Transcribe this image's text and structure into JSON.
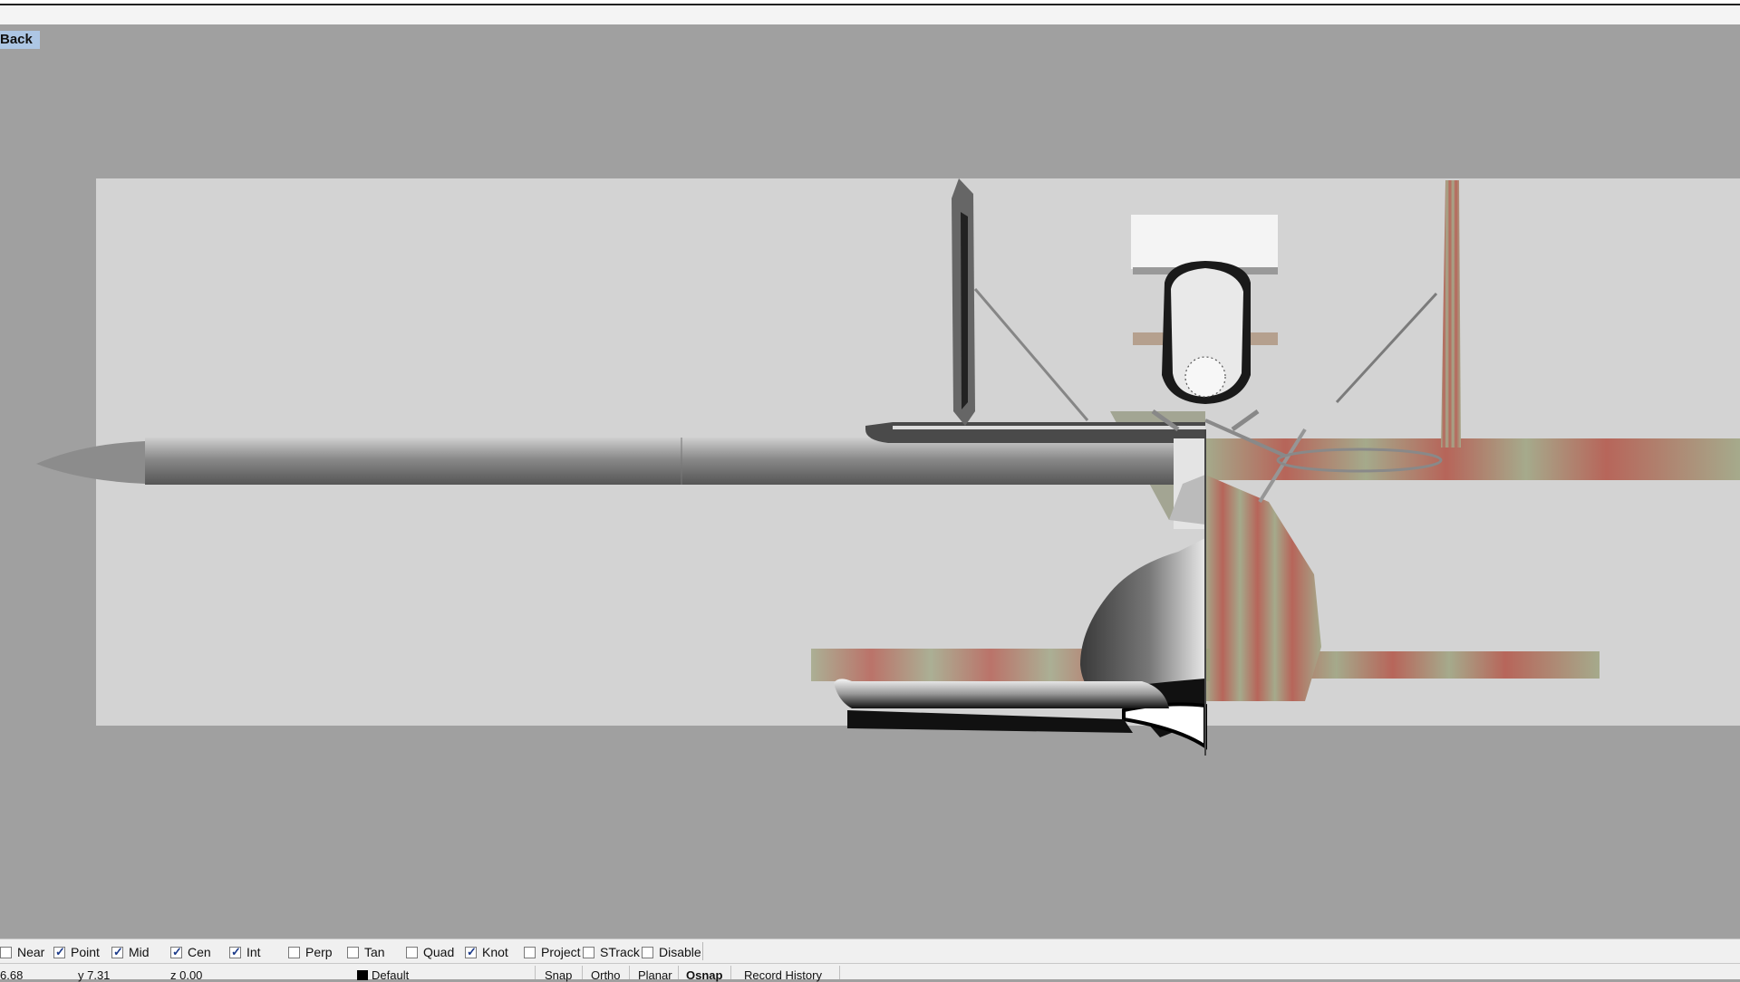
{
  "viewport": {
    "label": "Back"
  },
  "osnap": [
    {
      "label": "Near",
      "checked": false
    },
    {
      "label": "Point",
      "checked": true
    },
    {
      "label": "Mid",
      "checked": true
    },
    {
      "label": "Cen",
      "checked": true
    },
    {
      "label": "Int",
      "checked": true
    },
    {
      "label": "Perp",
      "checked": false
    },
    {
      "label": "Tan",
      "checked": false
    },
    {
      "label": "Quad",
      "checked": false
    },
    {
      "label": "Knot",
      "checked": true
    },
    {
      "label": "Project",
      "checked": false
    },
    {
      "label": "STrack",
      "checked": false
    },
    {
      "label": "Disable",
      "checked": false
    }
  ],
  "status": {
    "x": "6.68",
    "y": "y 7.31",
    "z": "z 0.00",
    "layer": "Default",
    "buttons": [
      "Snap",
      "Ortho",
      "Planar",
      "Osnap",
      "Record History"
    ],
    "active_button": "Osnap"
  },
  "colors": {
    "viewport_bg": "#a0a0a0",
    "background_image": "#d3d3d3",
    "label_highlight": "#adc6e4",
    "camo_green": "#9aa07a",
    "camo_red": "#b04a3c"
  }
}
